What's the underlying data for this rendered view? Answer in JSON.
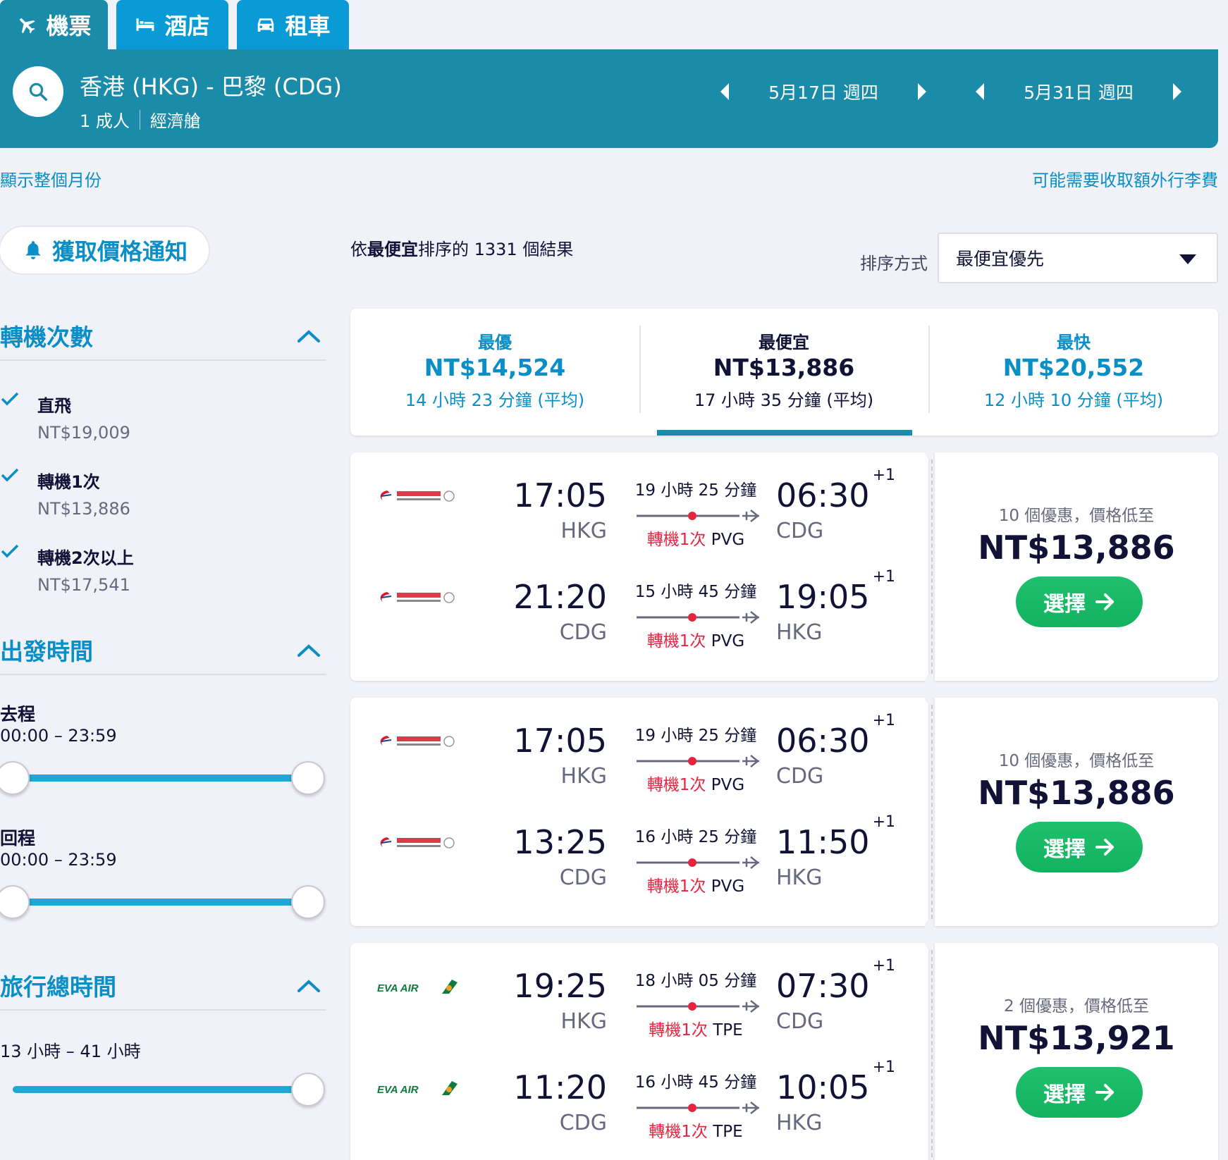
{
  "tabs": [
    {
      "label": "機票",
      "icon": "plane-icon"
    },
    {
      "label": "酒店",
      "icon": "bed-icon"
    },
    {
      "label": "租車",
      "icon": "car-icon"
    }
  ],
  "search": {
    "route": "香港 (HKG) - 巴黎 (CDG)",
    "adults": "1 成人",
    "cabin": "經濟艙",
    "outbound_date": "5月17日 週四",
    "return_date": "5月31日 週四"
  },
  "links": {
    "show_month": "顯示整個月份",
    "baggage_fee": "可能需要收取額外行李費"
  },
  "price_alert": "獲取價格通知",
  "filters": {
    "stops": {
      "title": "轉機次數",
      "options": [
        {
          "label": "直飛",
          "price": "NT$19,009",
          "checked": true
        },
        {
          "label": "轉機1次",
          "price": "NT$13,886",
          "checked": true
        },
        {
          "label": "轉機2次以上",
          "price": "NT$17,541",
          "checked": true
        }
      ]
    },
    "departure_time": {
      "title": "出發時間",
      "outbound_label": "去程",
      "outbound_range": "00:00 – 23:59",
      "return_label": "回程",
      "return_range": "00:00 – 23:59"
    },
    "duration": {
      "title": "旅行總時間",
      "range": "13 小時 – 41 小時"
    }
  },
  "results": {
    "prefix": "依",
    "sort_key": "最便宜",
    "suffix": "排序的 1331 個結果",
    "sort_label": "排序方式",
    "sort_value": "最便宜優先"
  },
  "summary": [
    {
      "title": "最優",
      "price": "NT$14,524",
      "duration": "14 小時 23 分鐘 (平均)"
    },
    {
      "title": "最便宜",
      "price": "NT$13,886",
      "duration": "17 小時 35 分鐘 (平均)"
    },
    {
      "title": "最快",
      "price": "NT$20,552",
      "duration": "12 小時 10 分鐘 (平均)"
    }
  ],
  "itineraries": [
    {
      "airline": "China Eastern",
      "legs": [
        {
          "dep_time": "17:05",
          "dep_code": "HKG",
          "duration": "19 小時 25 分鐘",
          "stops": "轉機1次",
          "via": "PVG",
          "arr_time": "06:30",
          "plus": "+1",
          "arr_code": "CDG"
        },
        {
          "dep_time": "21:20",
          "dep_code": "CDG",
          "duration": "15 小時 45 分鐘",
          "stops": "轉機1次",
          "via": "PVG",
          "arr_time": "19:05",
          "plus": "+1",
          "arr_code": "HKG"
        }
      ],
      "deals": "10 個優惠，價格低至",
      "price": "NT$13,886",
      "button": "選擇"
    },
    {
      "airline": "China Eastern",
      "legs": [
        {
          "dep_time": "17:05",
          "dep_code": "HKG",
          "duration": "19 小時 25 分鐘",
          "stops": "轉機1次",
          "via": "PVG",
          "arr_time": "06:30",
          "plus": "+1",
          "arr_code": "CDG"
        },
        {
          "dep_time": "13:25",
          "dep_code": "CDG",
          "duration": "16 小時 25 分鐘",
          "stops": "轉機1次",
          "via": "PVG",
          "arr_time": "11:50",
          "plus": "+1",
          "arr_code": "HKG"
        }
      ],
      "deals": "10 個優惠，價格低至",
      "price": "NT$13,886",
      "button": "選擇"
    },
    {
      "airline": "EVA AIR",
      "legs": [
        {
          "dep_time": "19:25",
          "dep_code": "HKG",
          "duration": "18 小時 05 分鐘",
          "stops": "轉機1次",
          "via": "TPE",
          "arr_time": "07:30",
          "plus": "+1",
          "arr_code": "CDG"
        },
        {
          "dep_time": "11:20",
          "dep_code": "CDG",
          "duration": "16 小時 45 分鐘",
          "stops": "轉機1次",
          "via": "TPE",
          "arr_time": "10:05",
          "plus": "+1",
          "arr_code": "HKG"
        }
      ],
      "deals": "2 個優惠，價格低至",
      "price": "NT$13,921",
      "button": "選擇"
    }
  ],
  "colors": {
    "header": "#1a8ba8",
    "tab": "#0a9bd7",
    "link": "#0a8ec7",
    "select_button": "#12b25f",
    "stop_red": "#e7243f"
  }
}
